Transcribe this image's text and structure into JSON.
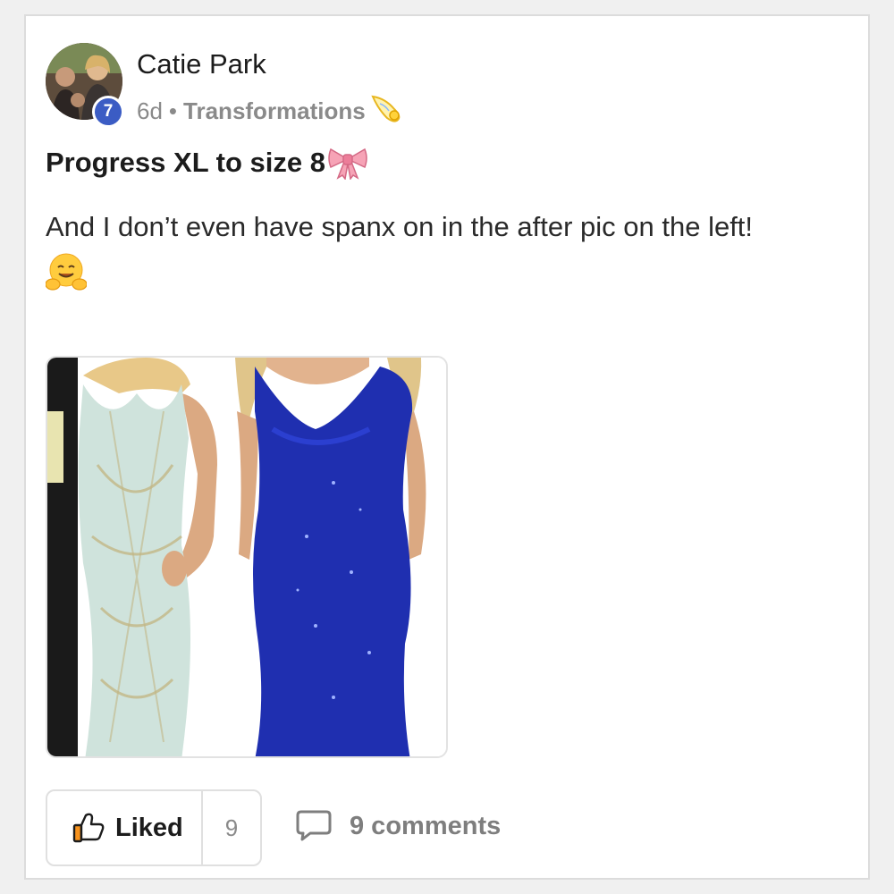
{
  "post": {
    "author": "Catie Park",
    "level_badge": "7",
    "time_ago": "6d",
    "separator": "•",
    "category": "Transformations",
    "category_icon": "comet-icon",
    "title": "Progress XL to size 8",
    "title_emoji": "ribbon-bow-icon",
    "body": "And I don’t even have spanx on in the after pic on the left!",
    "body_emoji": "hugging-face-icon"
  },
  "actions": {
    "like_label": "Liked",
    "like_count": "9",
    "comments_label": "9 comments"
  },
  "colors": {
    "badge": "#3b5cc4",
    "muted_text": "#8a8a8a",
    "border": "#e0e0e0",
    "dress_left": "#cfe3dc",
    "dress_right": "#1f2fb0"
  }
}
